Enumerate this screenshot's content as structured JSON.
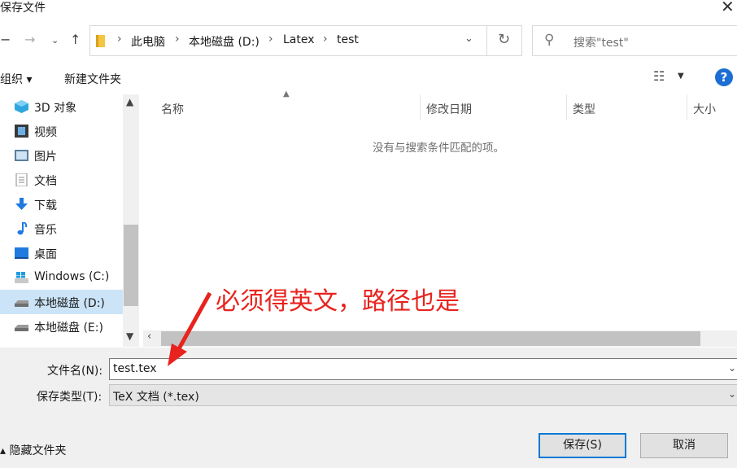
{
  "window": {
    "title": "保存文件",
    "close_icon": "close-icon"
  },
  "nav": {
    "back_icon": "back-arrow-icon",
    "forward_icon": "forward-arrow-icon",
    "recent_icon": "chevron-down-icon",
    "up_icon": "up-arrow-icon",
    "breadcrumb": [
      "此电脑",
      "本地磁盘 (D:)",
      "Latex",
      "test"
    ],
    "search_placeholder": "搜索\"test\""
  },
  "toolbar": {
    "organize": "组织 ▾",
    "new_folder": "新建文件夹",
    "help": "?"
  },
  "sidebar": {
    "items": [
      {
        "label": "3D 对象",
        "icon": "3d-objects-icon",
        "color": "#2fa6e0"
      },
      {
        "label": "视频",
        "icon": "video-icon",
        "color": "#3a3a3a"
      },
      {
        "label": "图片",
        "icon": "pictures-icon",
        "color": "#5a7e9c"
      },
      {
        "label": "文档",
        "icon": "documents-icon",
        "color": "#8a8a8a"
      },
      {
        "label": "下载",
        "icon": "download-icon",
        "color": "#1f7ae0"
      },
      {
        "label": "音乐",
        "icon": "music-icon",
        "color": "#1f7ae0"
      },
      {
        "label": "桌面",
        "icon": "desktop-icon",
        "color": "#1f7ae0"
      },
      {
        "label": "Windows (C:)",
        "icon": "windows-drive-icon",
        "color": "#8ab4d6"
      },
      {
        "label": "本地磁盘 (D:)",
        "icon": "drive-icon",
        "color": "#9a9a9a",
        "selected": true
      },
      {
        "label": "本地磁盘 (E:)",
        "icon": "drive-icon",
        "color": "#9a9a9a"
      }
    ]
  },
  "filelist": {
    "columns": [
      "名称",
      "修改日期",
      "类型",
      "大小"
    ],
    "empty_message": "没有与搜索条件匹配的项。"
  },
  "form": {
    "filename_label": "文件名(N):",
    "filename_value": "test.tex",
    "filetype_label": "保存类型(T):",
    "filetype_value": "TeX 文档 (*.tex)",
    "hide_folders": "隐藏文件夹",
    "save_button": "保存(S)",
    "cancel_button": "取消"
  },
  "annotation": {
    "text": "必须得英文，路径也是",
    "color": "#e8231e"
  }
}
